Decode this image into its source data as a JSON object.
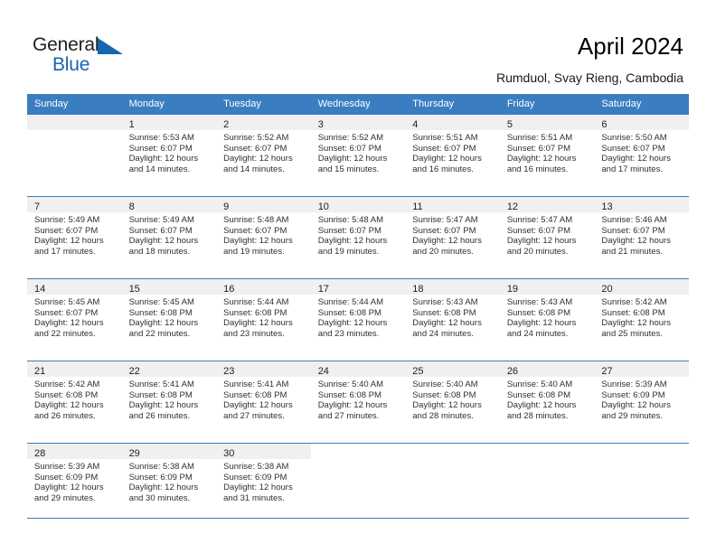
{
  "brand": {
    "name_part1": "General",
    "name_part2": "Blue",
    "accent_color": "#1565b0",
    "triangle_icon": "triangle-icon"
  },
  "header": {
    "title": "April 2024",
    "subtitle": "Rumduol, Svay Rieng, Cambodia"
  },
  "calendar": {
    "header_bg": "#3a7ec1",
    "daynum_band_bg": "#f0f0f0",
    "weekday_headers": [
      "Sunday",
      "Monday",
      "Tuesday",
      "Wednesday",
      "Thursday",
      "Friday",
      "Saturday"
    ],
    "weeks": [
      [
        {
          "day": "",
          "sunrise": "",
          "sunset": "",
          "daylight1": "",
          "daylight2": ""
        },
        {
          "day": "1",
          "sunrise": "Sunrise: 5:53 AM",
          "sunset": "Sunset: 6:07 PM",
          "daylight1": "Daylight: 12 hours",
          "daylight2": "and 14 minutes."
        },
        {
          "day": "2",
          "sunrise": "Sunrise: 5:52 AM",
          "sunset": "Sunset: 6:07 PM",
          "daylight1": "Daylight: 12 hours",
          "daylight2": "and 14 minutes."
        },
        {
          "day": "3",
          "sunrise": "Sunrise: 5:52 AM",
          "sunset": "Sunset: 6:07 PM",
          "daylight1": "Daylight: 12 hours",
          "daylight2": "and 15 minutes."
        },
        {
          "day": "4",
          "sunrise": "Sunrise: 5:51 AM",
          "sunset": "Sunset: 6:07 PM",
          "daylight1": "Daylight: 12 hours",
          "daylight2": "and 16 minutes."
        },
        {
          "day": "5",
          "sunrise": "Sunrise: 5:51 AM",
          "sunset": "Sunset: 6:07 PM",
          "daylight1": "Daylight: 12 hours",
          "daylight2": "and 16 minutes."
        },
        {
          "day": "6",
          "sunrise": "Sunrise: 5:50 AM",
          "sunset": "Sunset: 6:07 PM",
          "daylight1": "Daylight: 12 hours",
          "daylight2": "and 17 minutes."
        }
      ],
      [
        {
          "day": "7",
          "sunrise": "Sunrise: 5:49 AM",
          "sunset": "Sunset: 6:07 PM",
          "daylight1": "Daylight: 12 hours",
          "daylight2": "and 17 minutes."
        },
        {
          "day": "8",
          "sunrise": "Sunrise: 5:49 AM",
          "sunset": "Sunset: 6:07 PM",
          "daylight1": "Daylight: 12 hours",
          "daylight2": "and 18 minutes."
        },
        {
          "day": "9",
          "sunrise": "Sunrise: 5:48 AM",
          "sunset": "Sunset: 6:07 PM",
          "daylight1": "Daylight: 12 hours",
          "daylight2": "and 19 minutes."
        },
        {
          "day": "10",
          "sunrise": "Sunrise: 5:48 AM",
          "sunset": "Sunset: 6:07 PM",
          "daylight1": "Daylight: 12 hours",
          "daylight2": "and 19 minutes."
        },
        {
          "day": "11",
          "sunrise": "Sunrise: 5:47 AM",
          "sunset": "Sunset: 6:07 PM",
          "daylight1": "Daylight: 12 hours",
          "daylight2": "and 20 minutes."
        },
        {
          "day": "12",
          "sunrise": "Sunrise: 5:47 AM",
          "sunset": "Sunset: 6:07 PM",
          "daylight1": "Daylight: 12 hours",
          "daylight2": "and 20 minutes."
        },
        {
          "day": "13",
          "sunrise": "Sunrise: 5:46 AM",
          "sunset": "Sunset: 6:07 PM",
          "daylight1": "Daylight: 12 hours",
          "daylight2": "and 21 minutes."
        }
      ],
      [
        {
          "day": "14",
          "sunrise": "Sunrise: 5:45 AM",
          "sunset": "Sunset: 6:07 PM",
          "daylight1": "Daylight: 12 hours",
          "daylight2": "and 22 minutes."
        },
        {
          "day": "15",
          "sunrise": "Sunrise: 5:45 AM",
          "sunset": "Sunset: 6:08 PM",
          "daylight1": "Daylight: 12 hours",
          "daylight2": "and 22 minutes."
        },
        {
          "day": "16",
          "sunrise": "Sunrise: 5:44 AM",
          "sunset": "Sunset: 6:08 PM",
          "daylight1": "Daylight: 12 hours",
          "daylight2": "and 23 minutes."
        },
        {
          "day": "17",
          "sunrise": "Sunrise: 5:44 AM",
          "sunset": "Sunset: 6:08 PM",
          "daylight1": "Daylight: 12 hours",
          "daylight2": "and 23 minutes."
        },
        {
          "day": "18",
          "sunrise": "Sunrise: 5:43 AM",
          "sunset": "Sunset: 6:08 PM",
          "daylight1": "Daylight: 12 hours",
          "daylight2": "and 24 minutes."
        },
        {
          "day": "19",
          "sunrise": "Sunrise: 5:43 AM",
          "sunset": "Sunset: 6:08 PM",
          "daylight1": "Daylight: 12 hours",
          "daylight2": "and 24 minutes."
        },
        {
          "day": "20",
          "sunrise": "Sunrise: 5:42 AM",
          "sunset": "Sunset: 6:08 PM",
          "daylight1": "Daylight: 12 hours",
          "daylight2": "and 25 minutes."
        }
      ],
      [
        {
          "day": "21",
          "sunrise": "Sunrise: 5:42 AM",
          "sunset": "Sunset: 6:08 PM",
          "daylight1": "Daylight: 12 hours",
          "daylight2": "and 26 minutes."
        },
        {
          "day": "22",
          "sunrise": "Sunrise: 5:41 AM",
          "sunset": "Sunset: 6:08 PM",
          "daylight1": "Daylight: 12 hours",
          "daylight2": "and 26 minutes."
        },
        {
          "day": "23",
          "sunrise": "Sunrise: 5:41 AM",
          "sunset": "Sunset: 6:08 PM",
          "daylight1": "Daylight: 12 hours",
          "daylight2": "and 27 minutes."
        },
        {
          "day": "24",
          "sunrise": "Sunrise: 5:40 AM",
          "sunset": "Sunset: 6:08 PM",
          "daylight1": "Daylight: 12 hours",
          "daylight2": "and 27 minutes."
        },
        {
          "day": "25",
          "sunrise": "Sunrise: 5:40 AM",
          "sunset": "Sunset: 6:08 PM",
          "daylight1": "Daylight: 12 hours",
          "daylight2": "and 28 minutes."
        },
        {
          "day": "26",
          "sunrise": "Sunrise: 5:40 AM",
          "sunset": "Sunset: 6:08 PM",
          "daylight1": "Daylight: 12 hours",
          "daylight2": "and 28 minutes."
        },
        {
          "day": "27",
          "sunrise": "Sunrise: 5:39 AM",
          "sunset": "Sunset: 6:09 PM",
          "daylight1": "Daylight: 12 hours",
          "daylight2": "and 29 minutes."
        }
      ],
      [
        {
          "day": "28",
          "sunrise": "Sunrise: 5:39 AM",
          "sunset": "Sunset: 6:09 PM",
          "daylight1": "Daylight: 12 hours",
          "daylight2": "and 29 minutes."
        },
        {
          "day": "29",
          "sunrise": "Sunrise: 5:38 AM",
          "sunset": "Sunset: 6:09 PM",
          "daylight1": "Daylight: 12 hours",
          "daylight2": "and 30 minutes."
        },
        {
          "day": "30",
          "sunrise": "Sunrise: 5:38 AM",
          "sunset": "Sunset: 6:09 PM",
          "daylight1": "Daylight: 12 hours",
          "daylight2": "and 31 minutes."
        },
        {
          "day": "",
          "sunrise": "",
          "sunset": "",
          "daylight1": "",
          "daylight2": ""
        },
        {
          "day": "",
          "sunrise": "",
          "sunset": "",
          "daylight1": "",
          "daylight2": ""
        },
        {
          "day": "",
          "sunrise": "",
          "sunset": "",
          "daylight1": "",
          "daylight2": ""
        },
        {
          "day": "",
          "sunrise": "",
          "sunset": "",
          "daylight1": "",
          "daylight2": ""
        }
      ]
    ]
  }
}
